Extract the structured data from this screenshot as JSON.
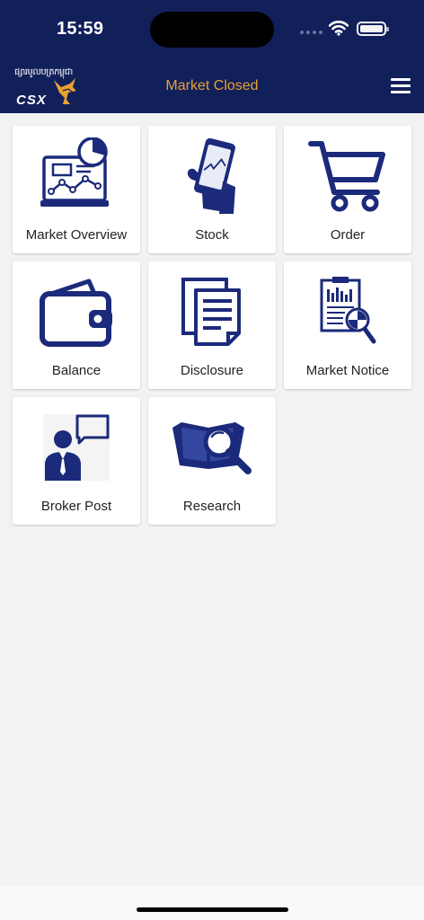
{
  "status_bar": {
    "time": "15:59"
  },
  "header": {
    "logo_khmer": "ផ្សារមូលបត្រកម្ពុជា",
    "logo_text": "CSX",
    "title": "Market Closed",
    "accent_color": "#e7a132",
    "bar_color": "#12205a"
  },
  "tiles": [
    {
      "label": "Market Overview",
      "icon": "market-overview-icon"
    },
    {
      "label": "Stock",
      "icon": "stock-phone-icon"
    },
    {
      "label": "Order",
      "icon": "cart-icon"
    },
    {
      "label": "Balance",
      "icon": "wallet-icon"
    },
    {
      "label": "Disclosure",
      "icon": "documents-icon"
    },
    {
      "label": "Market Notice",
      "icon": "report-magnifier-icon"
    },
    {
      "label": "Broker Post",
      "icon": "broker-chat-icon"
    },
    {
      "label": "Research",
      "icon": "book-magnifier-icon"
    }
  ],
  "icon_color": "#1b2a7a"
}
